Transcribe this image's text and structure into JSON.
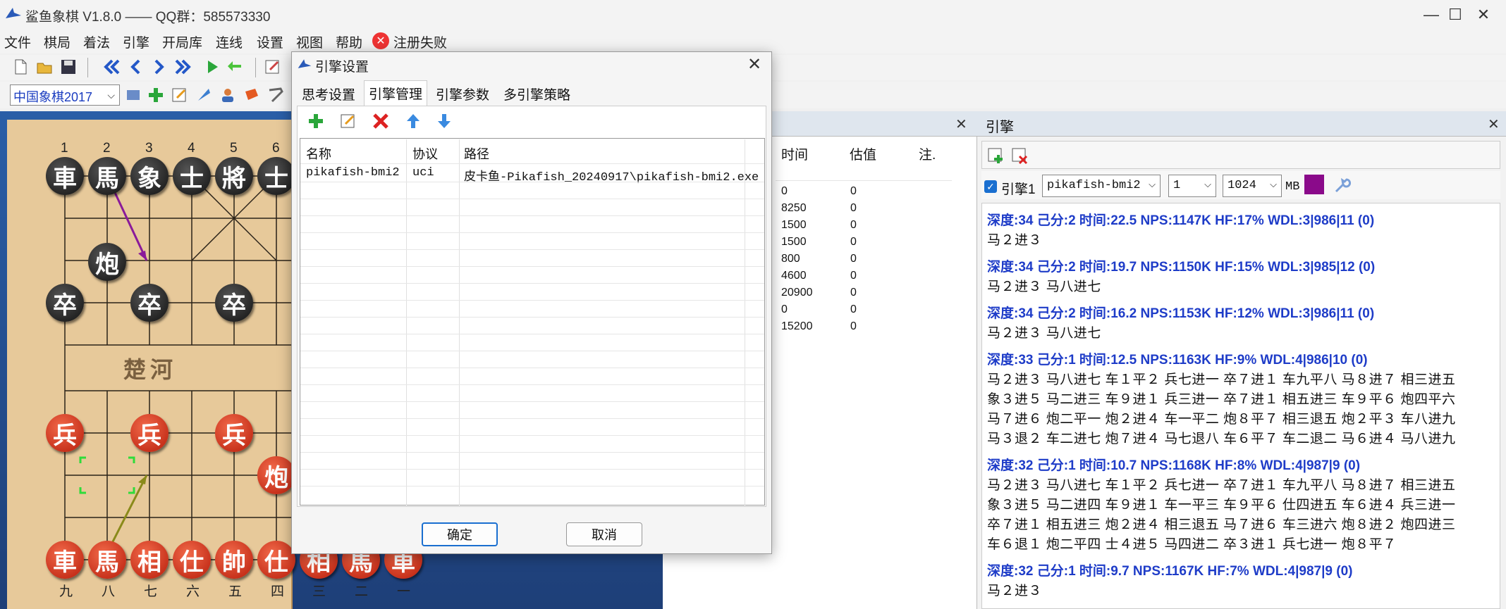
{
  "window": {
    "title": "鲨鱼象棋 V1.8.0  —— QQ群：585573330",
    "minimize_glyph": "—",
    "maximize_glyph": "☐",
    "close_glyph": "✕"
  },
  "menu": {
    "items": [
      "文件",
      "棋局",
      "着法",
      "引擎",
      "开局库",
      "连线",
      "设置",
      "视图",
      "帮助"
    ],
    "register_status": "注册失败",
    "register_icon": "x-circle-icon",
    "register_icon_glyph": "✕"
  },
  "toolbar": {
    "game_type": "中国象棋2017",
    "chevron": "⌵"
  },
  "board": {
    "top_files": [
      "1",
      "2",
      "3",
      "4",
      "5",
      "6"
    ],
    "bottom_files": [
      "九",
      "八",
      "七",
      "六",
      "五",
      "四",
      "三",
      "二",
      "一"
    ],
    "river_text": "楚河",
    "pieces_black": [
      "車",
      "馬",
      "象",
      "士",
      "將",
      "士",
      "炮",
      "卒",
      "卒",
      "卒"
    ],
    "pieces_red": [
      "兵",
      "兵",
      "兵",
      "炮",
      "車",
      "馬",
      "相",
      "仕",
      "帥",
      "仕",
      "相",
      "馬",
      "車"
    ],
    "arrow_colors": {
      "black_move": "#8a1a9a",
      "red_move": "#8a8a1a"
    }
  },
  "mid_panel": {
    "close_glyph": "✕",
    "headers": [
      "时间",
      "估值",
      "注."
    ],
    "time_values": [
      "0",
      "8250",
      "1500",
      "1500",
      "800",
      "4600",
      "20900",
      "0",
      "15200"
    ],
    "eval_values": [
      "0",
      "0",
      "0",
      "0",
      "0",
      "0",
      "0",
      "0",
      "0"
    ]
  },
  "engine_panel": {
    "title": "引擎",
    "close_glyph": "✕",
    "checkbox_glyph": "✓",
    "engine_label": "引擎1",
    "engine_name": "pikafish-bmi2",
    "threads": "1",
    "hash": "1024",
    "hash_unit": "MB",
    "chevron": "⌵",
    "swatch_color": "#8a0a8a",
    "analysis": [
      {
        "info": "深度:34  己分:2  时间:22.5  NPS:1147K HF:17% WDL:3|986|11 (0)",
        "pv": [
          "马２进３"
        ]
      },
      {
        "info": "深度:34  己分:2  时间:19.7  NPS:1150K HF:15% WDL:3|985|12 (0)",
        "pv": [
          "马２进３ 马八进七"
        ]
      },
      {
        "info": "深度:34  己分:2  时间:16.2  NPS:1153K HF:12% WDL:3|986|11 (0)",
        "pv": [
          "马２进３ 马八进七"
        ]
      },
      {
        "info": "深度:33  己分:1  时间:12.5  NPS:1163K HF:9% WDL:4|986|10 (0)",
        "pv": [
          "马２进３ 马八进七 车１平２ 兵七进一 卒７进１ 车九平八 马８进７ 相三进五",
          "象３进５ 马二进三 车９进１ 兵三进一 卒７进１ 相五进三 车９平６ 炮四平六",
          "马７进６ 炮二平一 炮２进４ 车一平二 炮８平７ 相三退五 炮２平３ 车八进九",
          "马３退２ 车二进七 炮７进４ 马七退八 车６平７ 车二退二 马６进４ 马八进九"
        ]
      },
      {
        "info": "深度:32  己分:1  时间:10.7  NPS:1168K HF:8% WDL:4|987|9 (0)",
        "pv": [
          "马２进３ 马八进七 车１平２ 兵七进一 卒７进１ 车九平八 马８进７ 相三进五",
          "象３进５ 马二进四 车９进１ 车一平三 车９平６ 仕四进五 车６进４ 兵三进一",
          "卒７进１ 相五进三 炮２进４ 相三退五 马７进６ 车三进六 炮８进２ 炮四进三",
          "车６退１ 炮二平四 士４进５ 马四进二 卒３进１ 兵七进一 炮８平７"
        ]
      },
      {
        "info": "深度:32  己分:1  时间:9.7  NPS:1167K HF:7% WDL:4|987|9 (0)",
        "pv": [
          "马２进３"
        ]
      }
    ]
  },
  "dialog": {
    "title": "引擎设置",
    "close_glyph": "✕",
    "tabs": [
      "思考设置",
      "引擎管理",
      "引擎参数",
      "多引擎策略"
    ],
    "active_tab": "引擎管理",
    "table_headers": [
      "名称",
      "协议",
      "路径"
    ],
    "rows": [
      {
        "name": "pikafish-bmi2",
        "protocol": "uci",
        "path": "皮卡鱼-Pikafish_20240917\\pikafish-bmi2.exe"
      }
    ],
    "ok_label": "确定",
    "cancel_label": "取消"
  }
}
